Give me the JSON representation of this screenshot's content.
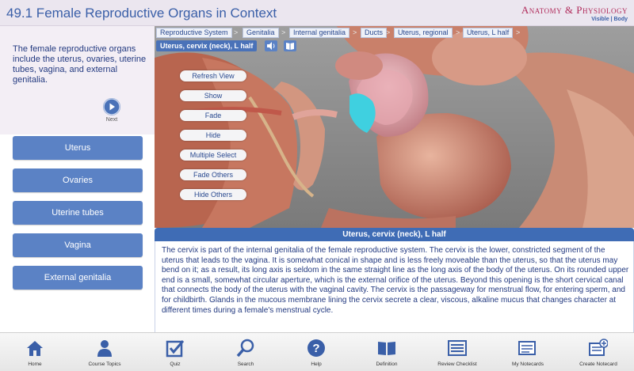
{
  "header": {
    "title": "49.1 Female Reproductive Organs in Context",
    "brand_main": "Anatomy & Physiology",
    "brand_sub": "Visible | Body"
  },
  "intro": {
    "text": "The female reproductive organs include the uterus, ovaries, uterine tubes, vagina, and external genitalia.",
    "next_label": "Next"
  },
  "nav": [
    {
      "label": "Uterus"
    },
    {
      "label": "Ovaries"
    },
    {
      "label": "Uterine tubes"
    },
    {
      "label": "Vagina"
    },
    {
      "label": "External genitalia"
    }
  ],
  "breadcrumbs": [
    {
      "label": "Reproductive System"
    },
    {
      "label": "Genitalia"
    },
    {
      "label": "Internal genitalia"
    },
    {
      "label": "Ducts"
    },
    {
      "label": "Uterus, regional"
    },
    {
      "label": "Uterus, L half"
    }
  ],
  "breadcrumb_separator": ">",
  "selected_part": "Uterus, cervix (neck), L half",
  "tools": [
    {
      "label": "Refresh View"
    },
    {
      "label": "Show"
    },
    {
      "label": "Fade"
    },
    {
      "label": "Hide"
    },
    {
      "label": "Multiple Select"
    },
    {
      "label": "Fade Others"
    },
    {
      "label": "Hide Others"
    }
  ],
  "description": {
    "title": "Uterus, cervix (neck), L half",
    "text": "The cervix is part of the internal genitalia of the female reproductive system. The cervix is the lower, constricted segment of the uterus that leads to the vagina. It is somewhat conical in shape and is less freely moveable than the uterus, so that the uterus may bend on it; as a result, its long axis is seldom in the same straight line as the long axis of the body of the uterus. On its rounded upper end is a small, somewhat circular aperture, which is the external orifice of the uterus. Beyond this opening is the short cervical canal that connects the body of the uterus with the vaginal cavity. The cervix is the passageway for menstrual flow, for entering sperm, and for childbirth. Glands in the mucous membrane lining the cervix secrete a clear, viscous, alkaline mucus that changes character at different times during a female's menstrual cycle."
  },
  "toolbar": [
    {
      "label": "Home",
      "icon": "home-icon"
    },
    {
      "label": "Course Topics",
      "icon": "person-icon"
    },
    {
      "label": "Quiz",
      "icon": "checkbox-icon"
    },
    {
      "label": "Search",
      "icon": "search-icon"
    },
    {
      "label": "Help",
      "icon": "help-icon"
    },
    {
      "label": "Definition",
      "icon": "book-icon"
    },
    {
      "label": "Review Checklist",
      "icon": "checklist-icon"
    },
    {
      "label": "My Notecards",
      "icon": "notecards-icon"
    },
    {
      "label": "Create Notecard",
      "icon": "create-notecard-icon"
    }
  ],
  "colors": {
    "accent": "#4a72b8",
    "nav_button": "#5b82c5",
    "title_blue": "#3a5fa8",
    "brand_red": "#b02a5a",
    "highlight_cyan": "#3fd0e0"
  }
}
